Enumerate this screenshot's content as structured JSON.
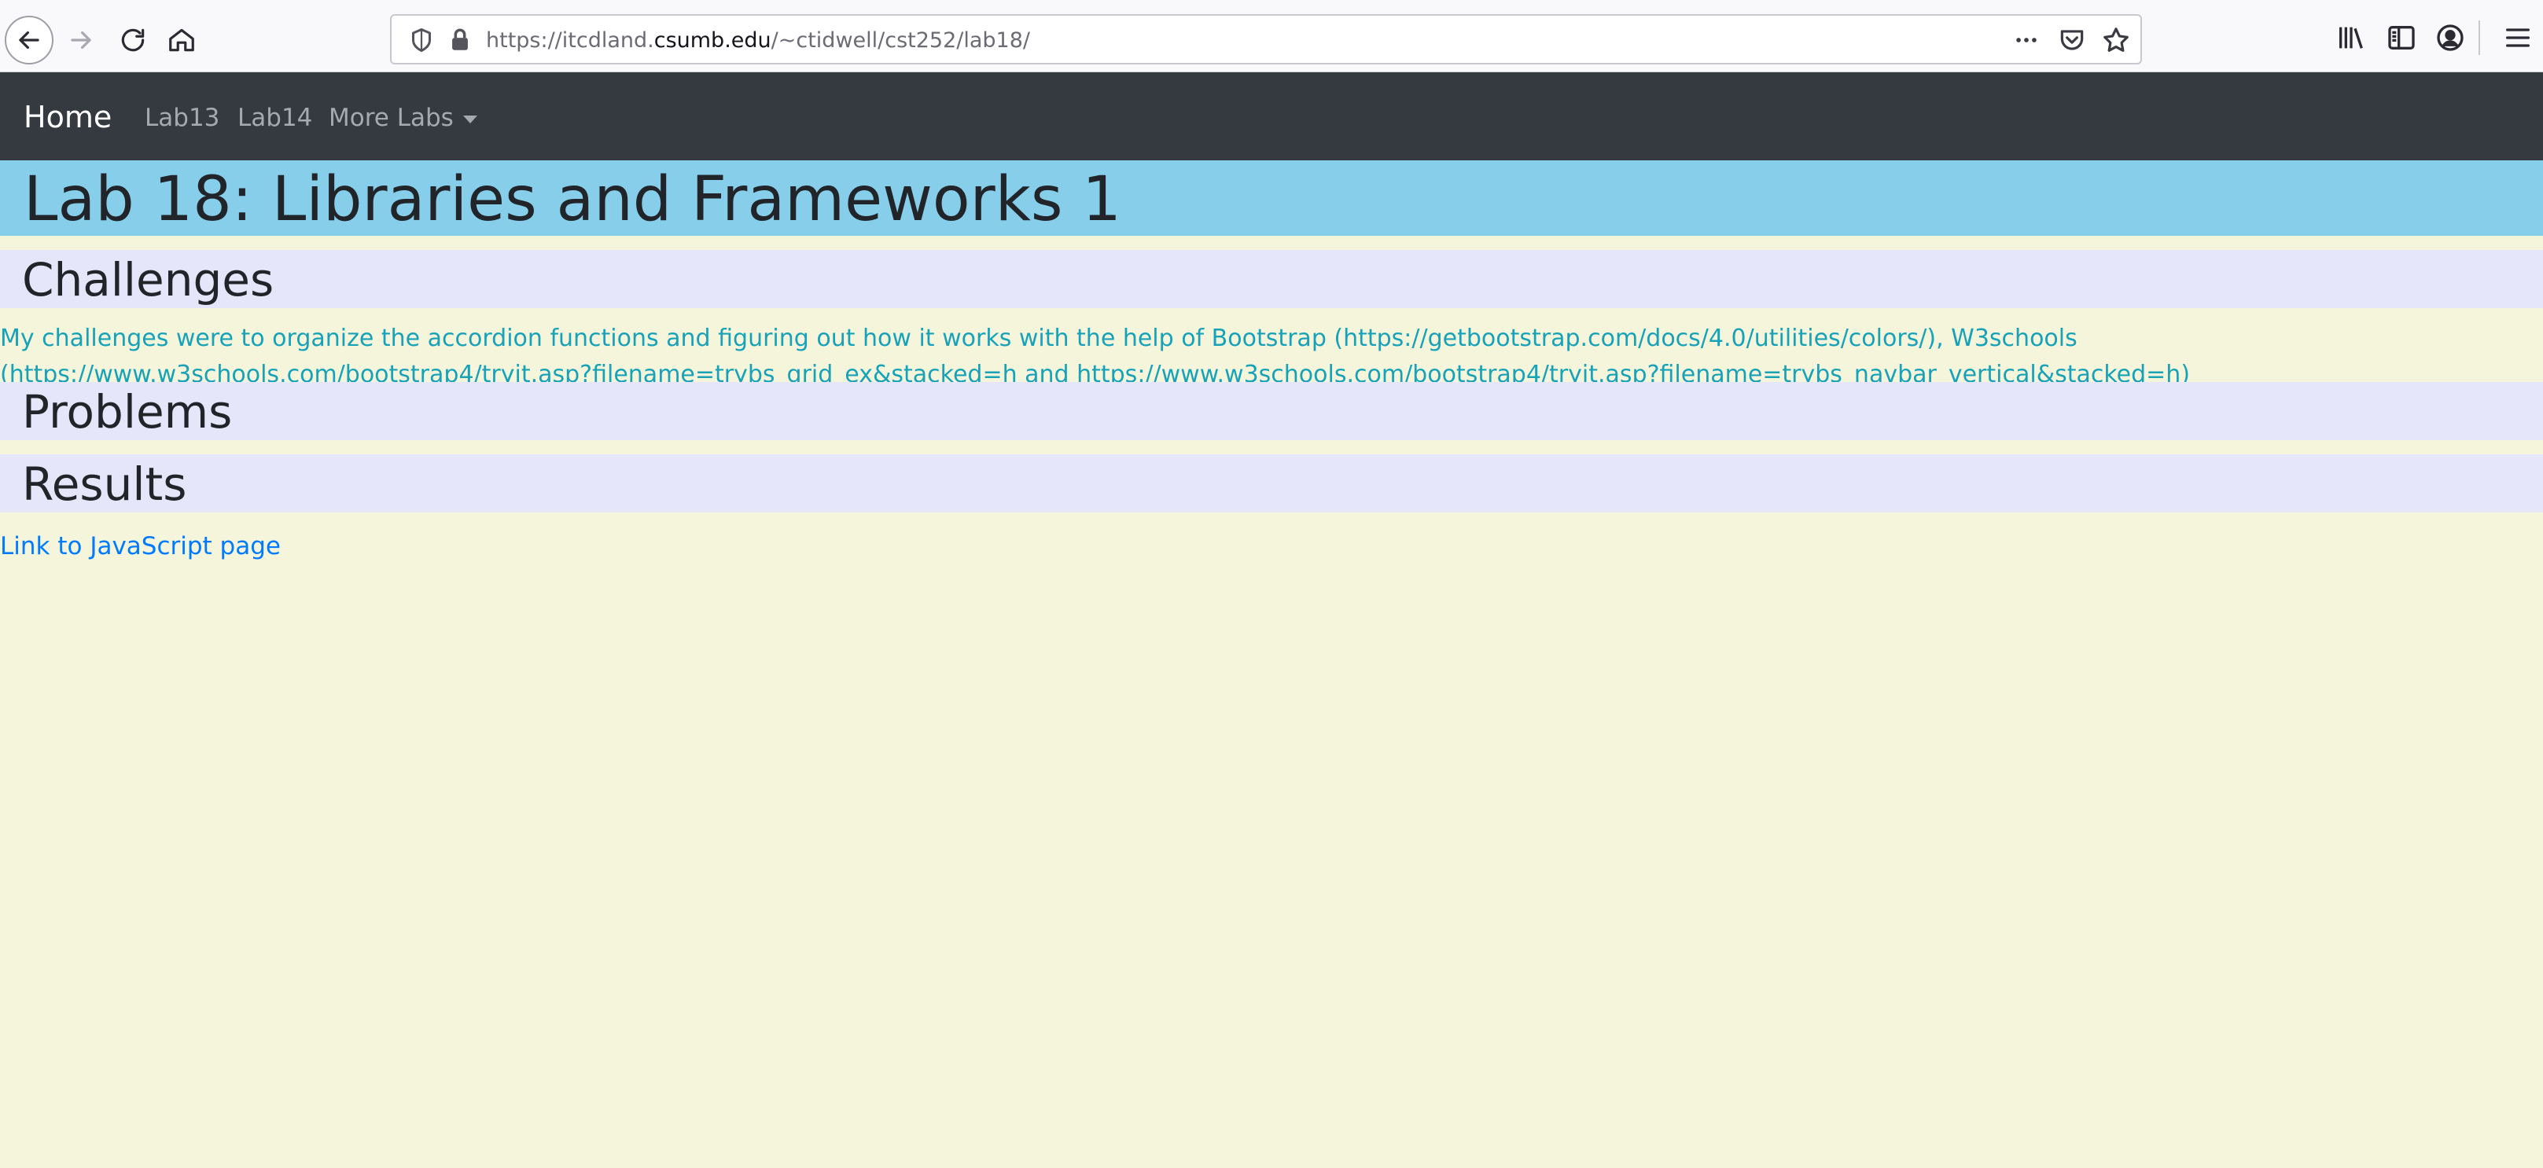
{
  "browser": {
    "url_prefix": "https://itcdland.",
    "url_domain": "csumb.edu",
    "url_path": "/~ctidwell/cst252/lab18/",
    "icons": [
      "back-arrow-icon",
      "forward-arrow-icon",
      "reload-icon",
      "home-icon",
      "shield-icon",
      "lock-icon",
      "more-dots-icon",
      "pocket-icon",
      "star-icon",
      "library-icon",
      "sidebar-icon",
      "account-icon",
      "hamburger-menu-icon"
    ]
  },
  "navbar": {
    "brand": "Home",
    "links": [
      "Lab13",
      "Lab14",
      "More Labs"
    ]
  },
  "page": {
    "title": "Lab 18: Libraries and Frameworks 1",
    "sections": {
      "challenges": {
        "heading": "Challenges",
        "text": "My challenges were to organize the accordion functions and figuring out how it works with the help of Bootstrap (https://getbootstrap.com/docs/4.0/utilities/colors/), W3schools (https://www.w3schools.com/bootstrap4/tryit.asp?filename=trybs_grid_ex&stacked=h and https://www.w3schools.com/bootstrap4/tryit.asp?filename=trybs_navbar_vertical&stacked=h)"
      },
      "problems": {
        "heading": "Problems"
      },
      "results": {
        "heading": "Results"
      }
    },
    "js_link": "Link to JavaScript page"
  },
  "colors": {
    "page_bg": "#f5f5dc",
    "navbar_bg": "#343a40",
    "title_band": "#87ceeb",
    "section_band": "#e6e6fa",
    "challenge_text": "#17a2b8",
    "link": "#007bff"
  }
}
